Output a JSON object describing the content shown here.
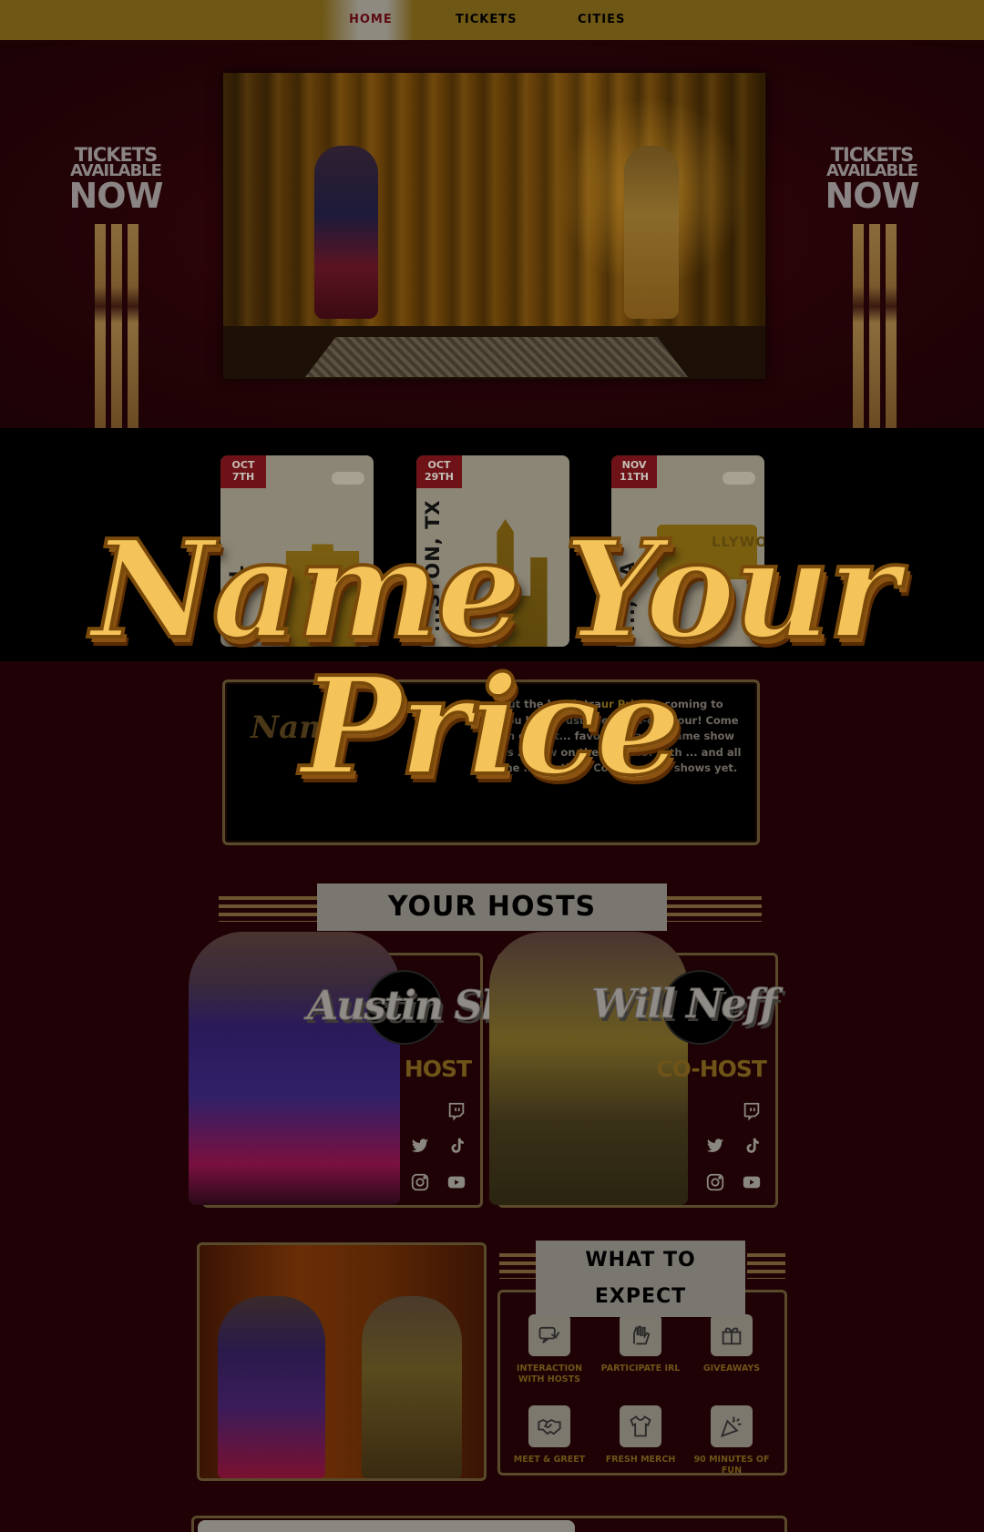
{
  "nav": {
    "home": "HOME",
    "tickets": "TICKETS",
    "cities": "CITIES"
  },
  "hero": {
    "left_badge": {
      "line1": "TICKETS",
      "line2": "AVAILABLE",
      "line3": "NOW"
    },
    "right_badge": {
      "line1": "TICKETS",
      "line2": "AVAILABLE",
      "line3": "NOW"
    }
  },
  "cities": [
    {
      "date_line1": "OCT",
      "date_line2": "7TH",
      "city": "..., FL"
    },
    {
      "date_line1": "OCT",
      "date_line2": "29TH",
      "city": "...STON, TX"
    },
    {
      "date_line1": "NOV",
      "date_line2": "11TH",
      "city": "..., CA",
      "landmark_text": "LLYWOOD"
    }
  ],
  "title": {
    "line1": "Name Your",
    "line2": "Price"
  },
  "about": {
    "logo_text": "Nam",
    "text_before": "Cut the laugh tra",
    "accent": "ur Price",
    "text_after": " is coming to you live ... ust see multi-city tour! Come on down t... favorite classic game show as ... how on the ... e U.S. with ... and all the ... Austin & Co. ... os ... s shows yet."
  },
  "hosts_header": "YOUR HOSTS",
  "hosts": [
    {
      "name": "Austin Show",
      "role": "HOST"
    },
    {
      "name": "Will Neff",
      "role": "CO-HOST"
    }
  ],
  "social_icons": [
    "twitch-icon",
    "twitter-icon",
    "tiktok-icon",
    "instagram-icon",
    "youtube-icon"
  ],
  "expect": {
    "header_line1": "WHAT TO",
    "header_line2": "EXPECT",
    "items": [
      {
        "icon": "interaction-icon",
        "label": "INTERACTION WITH HOSTS"
      },
      {
        "icon": "hands-raised-icon",
        "label": "PARTICIPATE IRL"
      },
      {
        "icon": "gift-icon",
        "label": "GIVEAWAYS"
      },
      {
        "icon": "handshake-icon",
        "label": "MEET & GREET"
      },
      {
        "icon": "tshirt-icon",
        "label": "FRESH MERCH"
      },
      {
        "icon": "party-popper-icon",
        "label": "90 MINUTES OF FUN"
      }
    ]
  },
  "colors": {
    "background": "#200206",
    "nav_bg": "#6f5716",
    "gold": "#f4c35a",
    "accent_red": "#6e1218",
    "muted_gold": "#6e5418"
  }
}
